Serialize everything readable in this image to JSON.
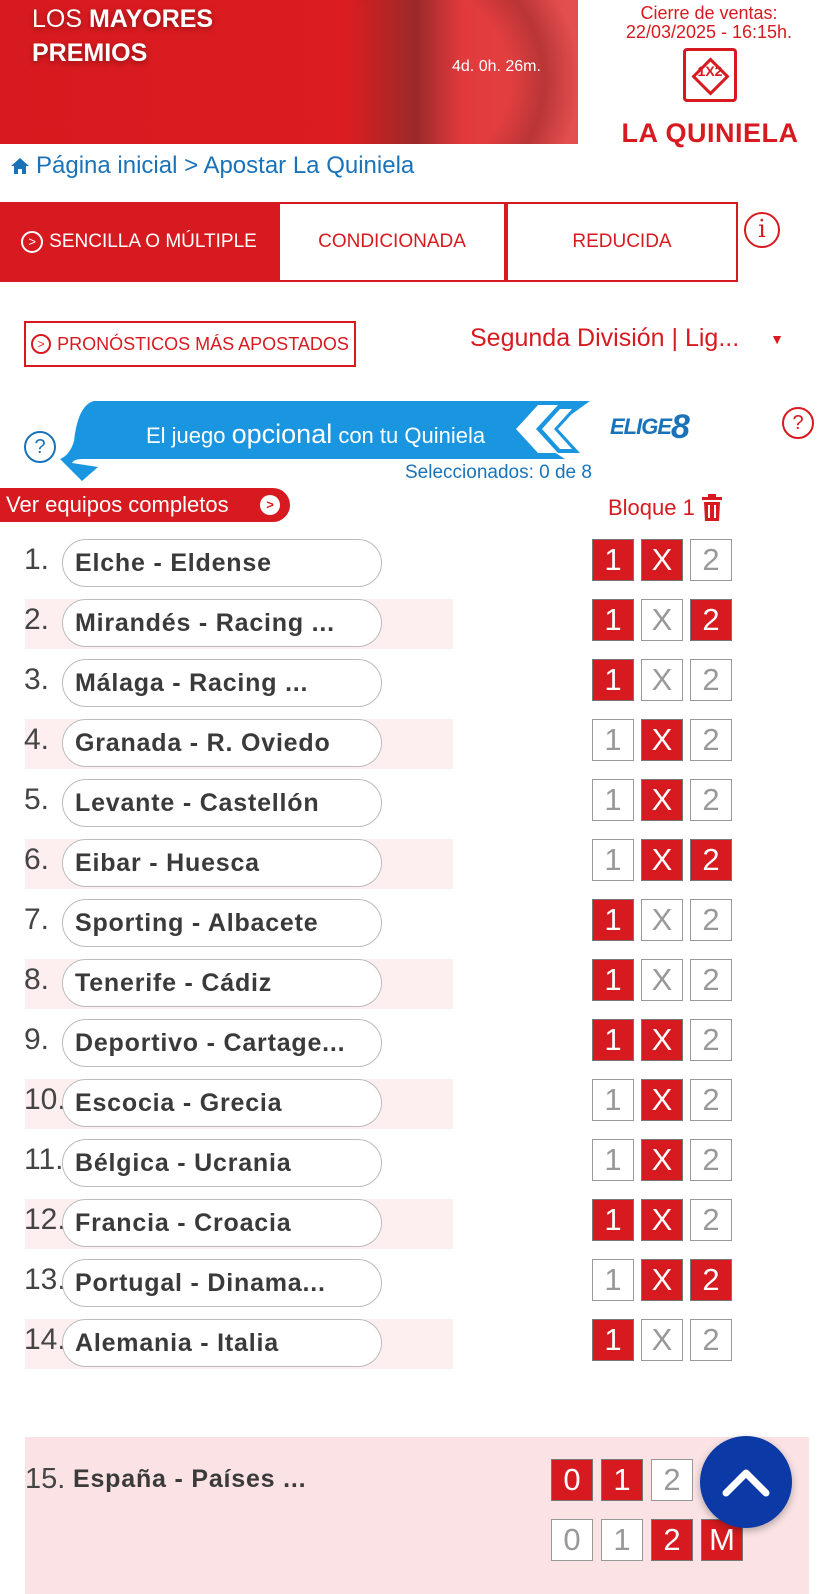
{
  "banner": {
    "promo_prefix": "LOS ",
    "promo_bold": "MAYORES",
    "promo_line2": "PREMIOS",
    "countdown": "4d. 0h. 26m.",
    "closing_label": "Cierre de ventas:",
    "closing_date": "22/03/2025 - 16:15h.",
    "logo_text": "LA QUINIELA",
    "brand_color": "#d71a1f"
  },
  "breadcrumb": {
    "icon": "home-icon",
    "text": "Página inicial > Apostar La Quiniela"
  },
  "tabs": [
    {
      "label": "SENCILLA O MÚLTIPLE",
      "active": true
    },
    {
      "label": "CONDICIONADA",
      "active": false
    },
    {
      "label": "REDUCIDA",
      "active": false
    }
  ],
  "info_label": "i",
  "popular_label": "PRONÓSTICOS MÁS APOSTADOS",
  "league": {
    "selected": "Segunda División | Lig...",
    "caret": "▼"
  },
  "elige8": {
    "text_a": "El juego ",
    "text_b": "opcional",
    "text_c": " con tu Quiniela",
    "logo_a": "ELIGE",
    "logo_b": "8",
    "selected_count": "Seleccionados: 0 de 8",
    "help": "?",
    "accent": "#1a96e0"
  },
  "teams_button": "Ver equipos completos",
  "block_label": "Bloque 1",
  "pick_labels": [
    "1",
    "X",
    "2"
  ],
  "matches": [
    {
      "num": "1.",
      "teams": "Elche - Eldense",
      "picks": [
        1,
        1,
        0
      ]
    },
    {
      "num": "2.",
      "teams": "Mirandés - Racing ...",
      "picks": [
        1,
        0,
        1
      ]
    },
    {
      "num": "3.",
      "teams": "Málaga - Racing ...",
      "picks": [
        1,
        0,
        0
      ]
    },
    {
      "num": "4.",
      "teams": "Granada - R. Oviedo",
      "picks": [
        0,
        1,
        0
      ]
    },
    {
      "num": "5.",
      "teams": "Levante - Castellón",
      "picks": [
        0,
        1,
        0
      ]
    },
    {
      "num": "6.",
      "teams": "Eibar - Huesca",
      "picks": [
        0,
        1,
        1
      ]
    },
    {
      "num": "7.",
      "teams": "Sporting - Albacete",
      "picks": [
        1,
        0,
        0
      ]
    },
    {
      "num": "8.",
      "teams": "Tenerife - Cádiz",
      "picks": [
        1,
        0,
        0
      ]
    },
    {
      "num": "9.",
      "teams": "Deportivo - Cartage...",
      "picks": [
        1,
        1,
        0
      ]
    },
    {
      "num": "10.",
      "teams": "Escocia - Grecia",
      "picks": [
        0,
        1,
        0
      ]
    },
    {
      "num": "11.",
      "teams": "Bélgica - Ucrania",
      "picks": [
        0,
        1,
        0
      ]
    },
    {
      "num": "12.",
      "teams": "Francia - Croacia",
      "picks": [
        1,
        1,
        0
      ]
    },
    {
      "num": "13.",
      "teams": "Portugal - Dinama...",
      "picks": [
        0,
        1,
        1
      ]
    },
    {
      "num": "14.",
      "teams": "Alemania - Italia",
      "picks": [
        1,
        0,
        0
      ]
    }
  ],
  "pleno": {
    "num": "15.",
    "teams": "España - Países ...",
    "row1": [
      {
        "label": "0",
        "on": true
      },
      {
        "label": "1",
        "on": true
      },
      {
        "label": "2",
        "on": false
      }
    ],
    "row2": [
      {
        "label": "0",
        "on": false
      },
      {
        "label": "1",
        "on": false
      },
      {
        "label": "2",
        "on": true
      },
      {
        "label": "M",
        "on": true
      }
    ]
  }
}
